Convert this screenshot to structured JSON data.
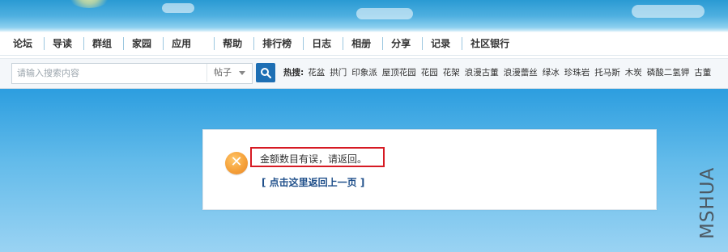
{
  "nav": {
    "items": [
      "论坛",
      "导读",
      "群组",
      "家园",
      "应用",
      "帮助",
      "排行榜",
      "日志",
      "相册",
      "分享",
      "记录",
      "社区银行"
    ]
  },
  "search": {
    "placeholder": "请输入搜索内容",
    "type_label": "帖子",
    "hot_label": "热搜:",
    "hot_items": [
      "花盆",
      "拱门",
      "印象派",
      "屋顶花园",
      "花园",
      "花架",
      "浪漫古董",
      "浪漫蕾丝",
      "绿冰",
      "珍珠岩",
      "托马斯",
      "木炭",
      "磷酸二氢钾",
      "古董"
    ]
  },
  "message": {
    "error_text": "金额数目有误，请返回。",
    "back_link": "[ 点击这里返回上一页 ]"
  },
  "watermark": "MSHUA",
  "colors": {
    "error_icon": "#f5a13a",
    "highlight_border": "#d61a23",
    "search_button": "#1e6fb4",
    "link": "#1f4f8a"
  }
}
